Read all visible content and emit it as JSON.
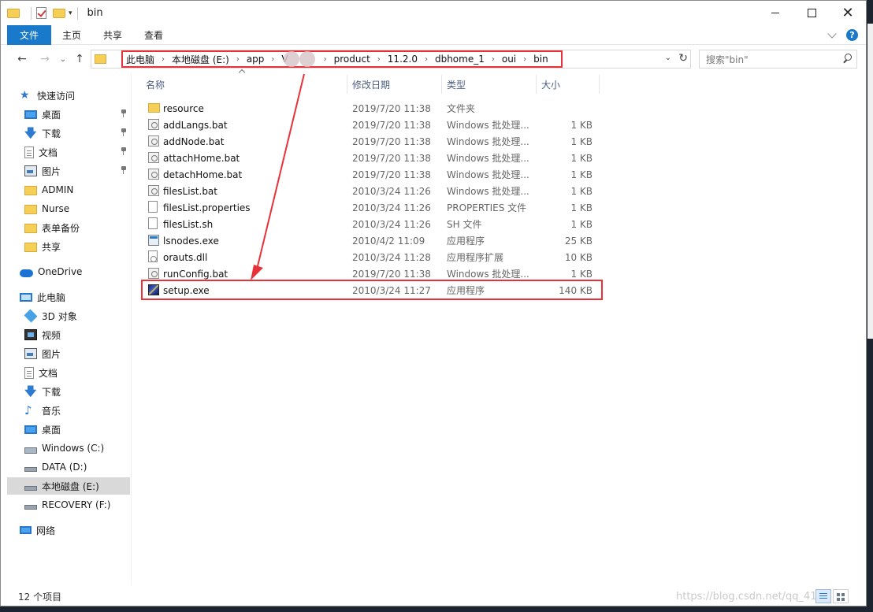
{
  "window": {
    "title": "bin",
    "controls": {
      "minimize": "—",
      "maximize": "□",
      "close": "✕"
    }
  },
  "ribbon": {
    "tabs": [
      "文件",
      "主页",
      "共享",
      "查看"
    ],
    "help": "?"
  },
  "nav": {
    "back": "←",
    "forward": "→",
    "up": "↑",
    "breadcrumbs": [
      "此电脑",
      "本地磁盘 (E:)",
      "app",
      "product",
      "11.2.0",
      "dbhome_1",
      "oui",
      "bin"
    ],
    "partial_crumb": "V",
    "search_placeholder": "搜索\"bin\""
  },
  "navpane": {
    "quick_access": "快速访问",
    "items": [
      {
        "label": "桌面",
        "icon": "desktop-icon",
        "pinned": true
      },
      {
        "label": "下载",
        "icon": "download-icon",
        "pinned": true
      },
      {
        "label": "文档",
        "icon": "document-icon",
        "pinned": true
      },
      {
        "label": "图片",
        "icon": "picture-icon",
        "pinned": true
      },
      {
        "label": "ADMIN",
        "icon": "folder-icon"
      },
      {
        "label": "Nurse",
        "icon": "folder-icon"
      },
      {
        "label": "表单备份",
        "icon": "folder-icon"
      },
      {
        "label": "共享",
        "icon": "folder-icon"
      }
    ],
    "onedrive": "OneDrive",
    "this_pc": "此电脑",
    "pc_items": [
      {
        "label": "3D 对象",
        "icon": "3d-objects-icon"
      },
      {
        "label": "视频",
        "icon": "video-icon"
      },
      {
        "label": "图片",
        "icon": "picture-icon"
      },
      {
        "label": "文档",
        "icon": "document-icon"
      },
      {
        "label": "下载",
        "icon": "download-icon"
      },
      {
        "label": "音乐",
        "icon": "music-icon"
      },
      {
        "label": "桌面",
        "icon": "desktop-icon"
      },
      {
        "label": "Windows (C:)",
        "icon": "windows-drive-icon"
      },
      {
        "label": "DATA (D:)",
        "icon": "drive-icon"
      },
      {
        "label": "本地磁盘 (E:)",
        "icon": "drive-icon",
        "selected": true
      },
      {
        "label": "RECOVERY (F:)",
        "icon": "drive-icon"
      }
    ],
    "network": "网络"
  },
  "columns": {
    "name": "名称",
    "date": "修改日期",
    "type": "类型",
    "size": "大小"
  },
  "files": [
    {
      "name": "resource",
      "date": "2019/7/20 11:38",
      "type": "文件夹",
      "size": "",
      "icon": "folder"
    },
    {
      "name": "addLangs.bat",
      "date": "2019/7/20 11:38",
      "type": "Windows 批处理...",
      "size": "1 KB",
      "icon": "bat"
    },
    {
      "name": "addNode.bat",
      "date": "2019/7/20 11:38",
      "type": "Windows 批处理...",
      "size": "1 KB",
      "icon": "bat"
    },
    {
      "name": "attachHome.bat",
      "date": "2019/7/20 11:38",
      "type": "Windows 批处理...",
      "size": "1 KB",
      "icon": "bat"
    },
    {
      "name": "detachHome.bat",
      "date": "2019/7/20 11:38",
      "type": "Windows 批处理...",
      "size": "1 KB",
      "icon": "bat"
    },
    {
      "name": "filesList.bat",
      "date": "2010/3/24 11:26",
      "type": "Windows 批处理...",
      "size": "1 KB",
      "icon": "bat"
    },
    {
      "name": "filesList.properties",
      "date": "2010/3/24 11:26",
      "type": "PROPERTIES 文件",
      "size": "1 KB",
      "icon": "txt"
    },
    {
      "name": "filesList.sh",
      "date": "2010/3/24 11:26",
      "type": "SH 文件",
      "size": "1 KB",
      "icon": "txt"
    },
    {
      "name": "lsnodes.exe",
      "date": "2010/4/2 11:09",
      "type": "应用程序",
      "size": "25 KB",
      "icon": "exe"
    },
    {
      "name": "orauts.dll",
      "date": "2010/3/24 11:28",
      "type": "应用程序扩展",
      "size": "10 KB",
      "icon": "dll"
    },
    {
      "name": "runConfig.bat",
      "date": "2019/7/20 11:38",
      "type": "Windows 批处理...",
      "size": "1 KB",
      "icon": "bat"
    },
    {
      "name": "setup.exe",
      "date": "2010/3/24 11:27",
      "type": "应用程序",
      "size": "140 KB",
      "icon": "setup"
    }
  ],
  "status": {
    "count": "12 个项目"
  },
  "watermark": "https://blog.csdn.net/qq_41"
}
